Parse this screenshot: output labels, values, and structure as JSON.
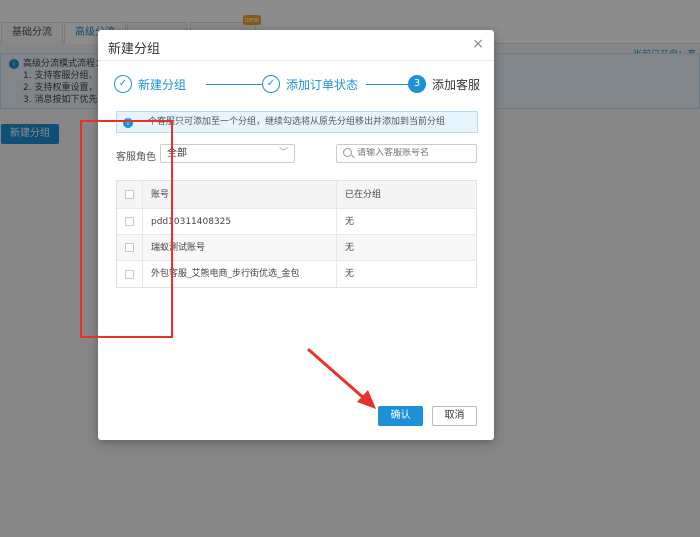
{
  "background": {
    "tabs": [
      {
        "label": "基础分流",
        "active": false
      },
      {
        "label": "高级分流",
        "active": true
      },
      {
        "label": "",
        "active": false
      },
      {
        "label": "",
        "active": false,
        "badge": "new"
      }
    ],
    "right_text": "当前已开启：高",
    "info_lines": [
      "高级分流模式流程：",
      "1. 支持客服分组、与",
      "2. 支持权重设置，",
      "3. 消息按如下优先级"
    ],
    "new_group_button": "新建分组"
  },
  "modal": {
    "title": "新建分组",
    "close_glyph": "×",
    "steps": [
      {
        "icon": "✓",
        "label": "新建分组",
        "state": "done"
      },
      {
        "icon": "✓",
        "label": "添加订单状态",
        "state": "done"
      },
      {
        "icon": "3",
        "label": "添加客服",
        "state": "current"
      }
    ],
    "notice": "一个客服只可添加至一个分组，继续勾选将从原先分组移出并添加到当前分组",
    "role_label": "客服角色",
    "role_value": "全部",
    "search_placeholder": "请输入客服账号名",
    "table": {
      "headers": [
        "账号",
        "已在分组"
      ],
      "rows": [
        {
          "account": "pdd10311408325",
          "group": "无"
        },
        {
          "account": "瑞蚁测试账号",
          "group": "无"
        },
        {
          "account": "外包客服_艾熊电商_步行街优选_金包",
          "group": "无"
        }
      ]
    },
    "confirm_button": "确认",
    "cancel_button": "取消"
  },
  "colors": {
    "primary": "#1e90d6",
    "annotation": "#e5322d"
  }
}
